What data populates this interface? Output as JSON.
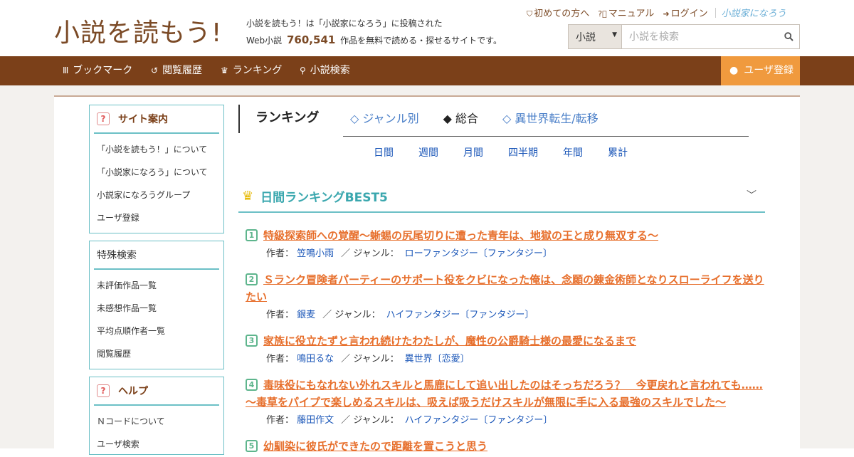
{
  "header": {
    "logo": "小説を読もう!",
    "tagline_1": "小説を読もう！は「小説家になろう」に投稿された",
    "tagline_2_prefix": "Web小説",
    "work_count": "760,541",
    "tagline_2_suffix": "作品を無料で読める・探せるサイトです。",
    "links": {
      "first_time": "初めての方へ",
      "manual": "マニュアル",
      "login": "ログイン",
      "narou": "小説家になろう"
    },
    "search": {
      "select_value": "小説",
      "placeholder": "小説を検索"
    }
  },
  "nav": {
    "bookmark": "ブックマーク",
    "history": "閲覧履歴",
    "ranking": "ランキング",
    "search": "小説検索",
    "register": "ユーザ登録"
  },
  "sidebar": {
    "site_guide": {
      "title": "サイト案内",
      "items": [
        "「小説を読もう！」について",
        "「小説家になろう」について",
        "小説家になろうグループ",
        "ユーザ登録"
      ]
    },
    "special_search": {
      "title": "特殊検索",
      "items": [
        "未評価作品一覧",
        "未感想作品一覧",
        "平均点順作者一覧",
        "閲覧履歴"
      ]
    },
    "help": {
      "title": "ヘルプ",
      "items": [
        "Ｎコードについて",
        "ユーザ検索"
      ]
    }
  },
  "ranking": {
    "title": "ランキング",
    "tabs": [
      "◇ ジャンル別",
      "◆ 総合",
      "◇ 異世界転生/転移"
    ],
    "periods": [
      "日間",
      "週間",
      "月間",
      "四半期",
      "年間",
      "累計"
    ],
    "best_title": "日間ランキングBEST5",
    "author_label": "作者：",
    "genre_label": "／ ジャンル：",
    "entries": [
      {
        "rank": "1",
        "title": "特級探索師への覚醒～蜥蜴の尻尾切りに遭った青年は、地獄の王と成り無双する～",
        "author": "笠鳴小雨",
        "genre": "ローファンタジー〔ファンタジー〕"
      },
      {
        "rank": "2",
        "title": "Ｓランク冒険者パーティーのサポート役をクビになった俺は、念願の錬金術師となりスローライフを送りたい",
        "author": "銀麦",
        "genre": "ハイファンタジー〔ファンタジー〕"
      },
      {
        "rank": "3",
        "title": "家族に役立たずと言われ続けたわたしが、魔性の公爵騎士様の最愛になるまで",
        "author": "鳴田るな",
        "genre": "異世界〔恋愛〕"
      },
      {
        "rank": "4",
        "title": "毒味役にもなれない外れスキルと馬鹿にして追い出したのはそっちだろう？　今更戻れと言われても……～毒草をパイプで楽しめるスキルは、吸えば吸うだけスキルが無限に手に入る最強のスキルでした～",
        "author": "藤田作文",
        "genre": "ハイファンタジー〔ファンタジー〕"
      },
      {
        "rank": "5",
        "title": "幼馴染に彼氏ができたので距離を置こうと思う",
        "author": "",
        "genre": ""
      }
    ]
  }
}
